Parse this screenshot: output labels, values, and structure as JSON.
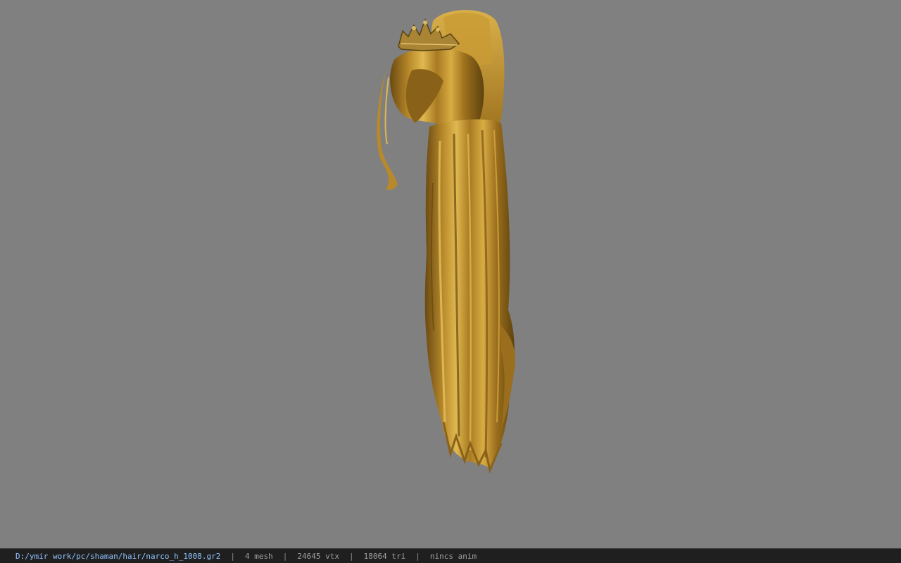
{
  "viewport": {
    "background_color": "#808080",
    "model": {
      "kind": "long golden hair with tiara",
      "hair_color": "#b8892a",
      "highlight_color": "#e0b850",
      "shadow_color": "#6a4a12"
    }
  },
  "statusbar": {
    "path": "D:/ymir work/pc/shaman/hair/narco_h_1008.gr2",
    "separator": "|",
    "mesh": "4 mesh",
    "vtx": "24645 vtx",
    "tri": "18064 tri",
    "anim": "nincs anim",
    "path_color": "#8fc3ff",
    "background_color": "#1f1f1f"
  }
}
